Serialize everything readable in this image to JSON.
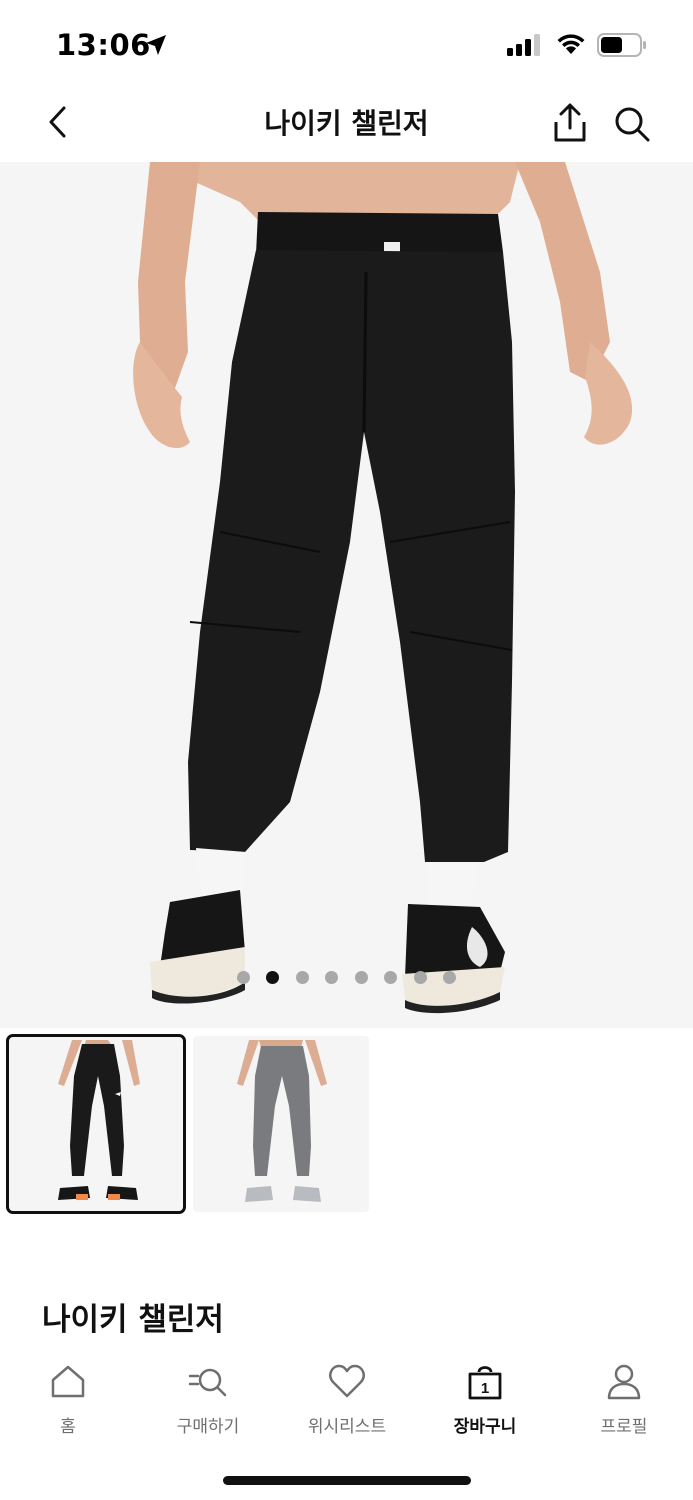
{
  "status_bar": {
    "time": "13:06",
    "icons": [
      "location-arrow-icon",
      "cellular-signal-icon",
      "wifi-icon",
      "battery-icon"
    ]
  },
  "header": {
    "title": "나이키 챌린저",
    "back_icon": "chevron-left-icon",
    "share_icon": "share-icon",
    "search_icon": "search-icon"
  },
  "hero": {
    "image_label": "product-photo-back-view-black-pants",
    "carousel_total": 8,
    "carousel_active": 1
  },
  "thumbnails": [
    {
      "colorway": "black",
      "selected": true
    },
    {
      "colorway": "grey",
      "selected": false
    }
  ],
  "product": {
    "title": "나이키 챌린저"
  },
  "bottom_nav": {
    "items": [
      {
        "label": "홈",
        "icon": "home-icon",
        "active": false
      },
      {
        "label": "구매하기",
        "icon": "shop-search-icon",
        "active": false
      },
      {
        "label": "위시리스트",
        "icon": "heart-icon",
        "active": false
      },
      {
        "label": "장바구니",
        "icon": "bag-icon",
        "active": true,
        "badge": "1"
      },
      {
        "label": "프로필",
        "icon": "person-icon",
        "active": false
      }
    ]
  },
  "colors": {
    "text_primary": "#111111",
    "text_secondary": "#6f6f6f",
    "image_background": "#f5f5f5",
    "pants_black": "#1a1a1a",
    "pants_grey": "#7a7b7f"
  }
}
